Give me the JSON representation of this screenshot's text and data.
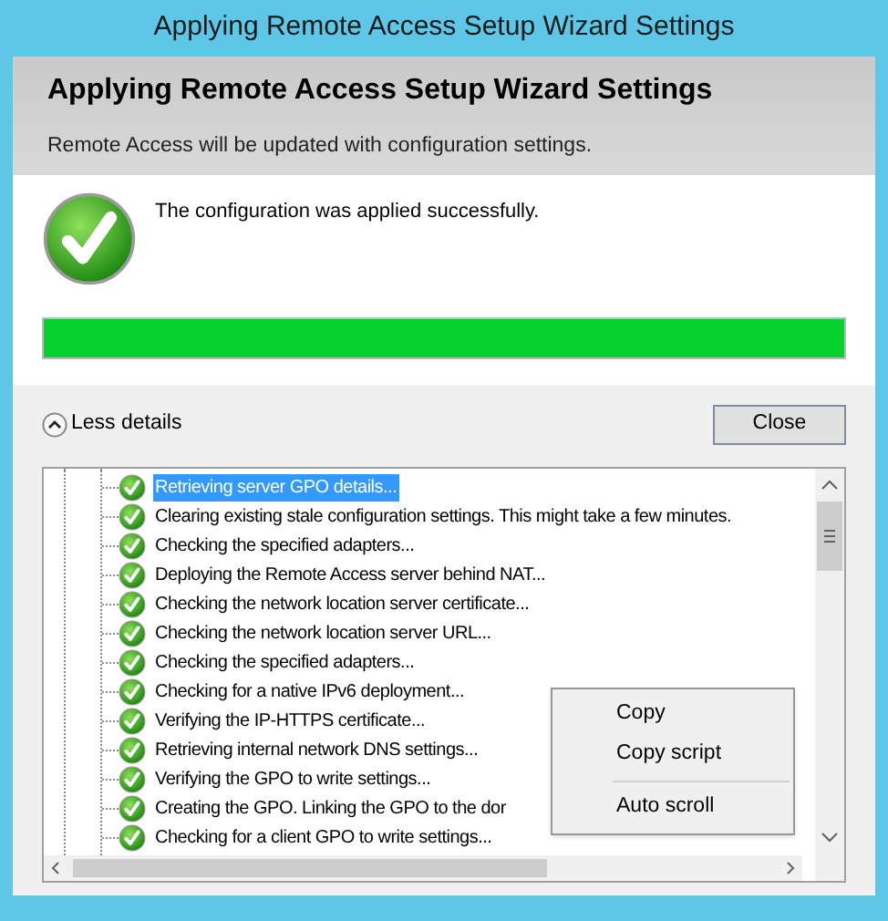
{
  "window": {
    "title": "Applying Remote Access Setup Wizard Settings"
  },
  "header": {
    "title": "Applying Remote Access Setup Wizard Settings",
    "subtitle": "Remote Access will be updated with configuration settings."
  },
  "result": {
    "message": "The configuration was applied successfully."
  },
  "progress": {
    "level": 1
  },
  "details_toggle": {
    "label": "Less details",
    "expanded": true
  },
  "close_button": "Close",
  "log": [
    {
      "text": "Retrieving server GPO details...",
      "selected": true
    },
    {
      "text": "Clearing existing stale configuration settings. This might take a few minutes.",
      "selected": false
    },
    {
      "text": "Checking the specified adapters...",
      "selected": false
    },
    {
      "text": "Deploying the Remote Access server behind NAT...",
      "selected": false
    },
    {
      "text": "Checking the network location server certificate...",
      "selected": false
    },
    {
      "text": "Checking the network location server URL...",
      "selected": false
    },
    {
      "text": "Checking the specified adapters...",
      "selected": false
    },
    {
      "text": "Checking for a native IPv6 deployment...",
      "selected": false
    },
    {
      "text": "Verifying the IP-HTTPS certificate...",
      "selected": false
    },
    {
      "text": "Retrieving internal network DNS settings...",
      "selected": false
    },
    {
      "text": "Verifying the GPO to write settings...",
      "selected": false
    },
    {
      "text": "Creating the GPO. Linking the GPO to the dor",
      "selected": false
    },
    {
      "text": "Checking for a client GPO to write settings...",
      "selected": false
    }
  ],
  "context_menu": [
    {
      "kind": "item",
      "label": "Copy"
    },
    {
      "kind": "item",
      "label": "Copy script"
    },
    {
      "kind": "separator"
    },
    {
      "kind": "item",
      "label": "Auto scroll"
    }
  ]
}
